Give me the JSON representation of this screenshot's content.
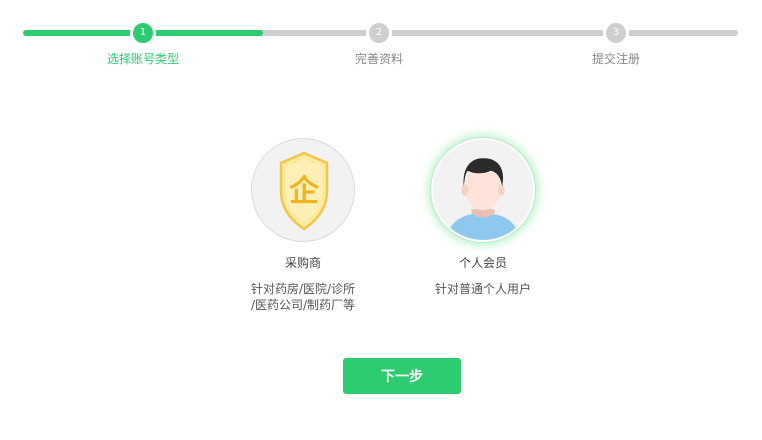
{
  "stepper": {
    "progress": 0.33,
    "steps": [
      {
        "number": "1",
        "label": "选择账号类型",
        "state": "active"
      },
      {
        "number": "2",
        "label": "完善资料",
        "state": "inactive"
      },
      {
        "number": "3",
        "label": "提交注册",
        "state": "inactive"
      }
    ]
  },
  "account_types": [
    {
      "title": "采购商",
      "description_line1": "针对药房/医院/诊所",
      "description_line2": "/医药公司/制药厂等",
      "icon": "enterprise-shield-icon",
      "badge_char": "企",
      "selected": false
    },
    {
      "title": "个人会员",
      "description_line1": "针对普通个人用户",
      "icon": "person-avatar-icon",
      "selected": true
    }
  ],
  "next_button": {
    "label": "下一步"
  },
  "colors": {
    "accent": "#2ecc71",
    "inactive": "#cfcfcf",
    "shield_fill": "#fde9a0",
    "shield_stroke": "#f3c64a"
  }
}
